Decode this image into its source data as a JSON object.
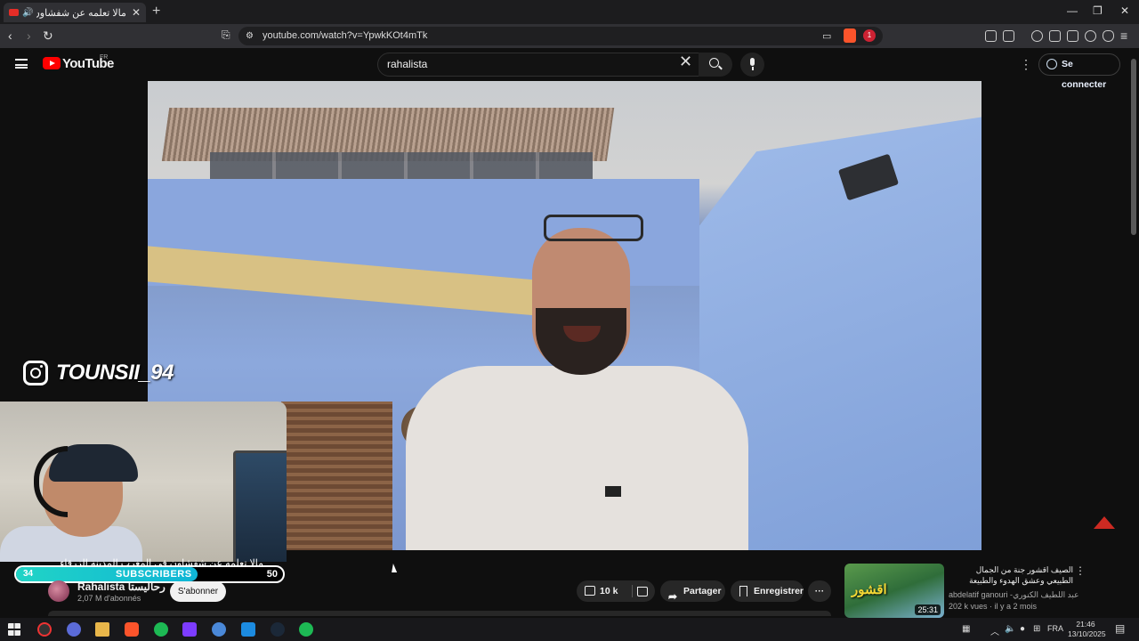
{
  "browser": {
    "tab_title": "مالا تعلمه عن شفشاون في الـ",
    "url": "youtube.com/watch?v=YpwkKOt4mTk",
    "notif_count": "1"
  },
  "youtube": {
    "logo_text": "YouTube",
    "country": "FR",
    "search_value": "rahalista",
    "signin_label": "Se connecter"
  },
  "overlay": {
    "instagram_handle": "TOUNSII_94",
    "subtitle_text": "مالا تعلمه عن شفشاون في المغرب المدينة الزرقاء",
    "sub_current": "34",
    "sub_label": "SUBSCRIBERS",
    "sub_goal": "50",
    "sub_progress": 0.68
  },
  "channel": {
    "name": "Rahalista رحاليستا",
    "subscribers": "2,07 M d'abonnés",
    "subscribe_label": "S'abonner"
  },
  "actions": {
    "likes": "10 k",
    "share_label": "Partager",
    "save_label": "Enregistrer",
    "more_label": "···"
  },
  "recommendation": {
    "title": "الصيف اقشور جنة من الجمال الطبيعي وعشق الهدوء والطبيعة",
    "channel": "abdelatif ganouri -عبد اللطيف الكنوري",
    "meta": "202 k vues · il y a 2 mois",
    "duration": "25:31",
    "thumb_text": "اقشور"
  },
  "taskbar": {
    "language": "FRA",
    "time": "21:46",
    "date": "13/10/2025"
  },
  "colors": {
    "accent_red": "#ff0000",
    "sub_bar": "#21d4c6",
    "background": "#0f0f0f"
  }
}
